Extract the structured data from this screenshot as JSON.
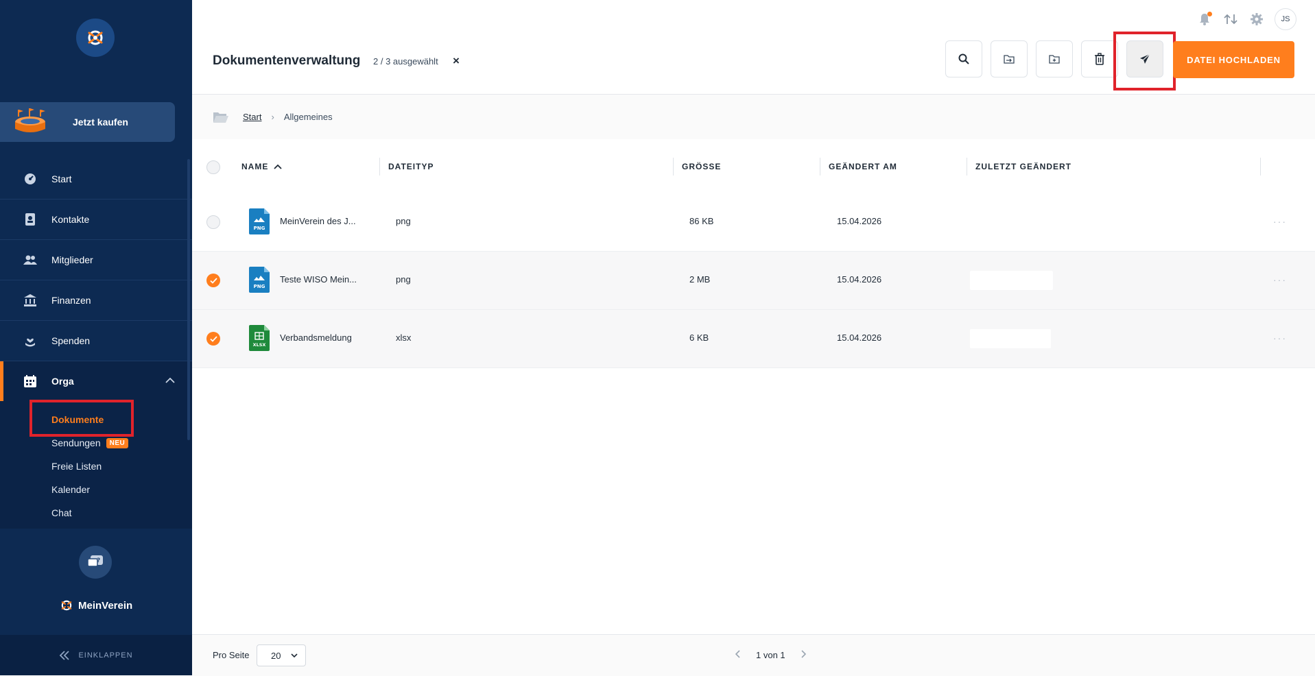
{
  "sidebar": {
    "buy_label": "Jetzt kaufen",
    "nav": [
      {
        "label": "Start",
        "icon": "dashboard-icon"
      },
      {
        "label": "Kontakte",
        "icon": "contact-card-icon"
      },
      {
        "label": "Mitglieder",
        "icon": "members-icon"
      },
      {
        "label": "Finanzen",
        "icon": "bank-icon"
      },
      {
        "label": "Spenden",
        "icon": "donation-hand-icon"
      },
      {
        "label": "Orga",
        "icon": "calendar-grid-icon"
      }
    ],
    "sub": [
      {
        "label": "Dokumente",
        "active": true
      },
      {
        "label": "Sendungen",
        "badge": "NEU"
      },
      {
        "label": "Freie Listen"
      },
      {
        "label": "Kalender"
      },
      {
        "label": "Chat"
      }
    ],
    "brand": "MeinVerein",
    "collapse_label": "EINKLAPPEN"
  },
  "topbar": {
    "avatar_initials": "JS",
    "icons": [
      "bell-icon",
      "sort-arrows-icon",
      "gear-icon"
    ]
  },
  "header": {
    "title": "Dokumentenverwaltung",
    "selected_count": "2 / 3 ausgewählt",
    "clear_symbol": "×",
    "upload_label": "DATEI HOCHLADEN",
    "tools": [
      "search-icon",
      "move-file-icon",
      "new-folder-icon",
      "trash-icon",
      "send-icon"
    ]
  },
  "breadcrumb": {
    "root": "Start",
    "separator": "›",
    "current": "Allgemeines"
  },
  "table": {
    "columns": {
      "name": "NAME",
      "type": "DATEITYP",
      "size": "GRÖSSE",
      "changed": "GEÄNDERT AM",
      "last_changed": "ZULETZT GEÄNDERT"
    },
    "rows": [
      {
        "name": "MeinVerein des J...",
        "type": "png",
        "size": "86 KB",
        "changed": "15.04.2026",
        "selected": false,
        "icon_label": "PNG",
        "icon_color": "#1a7fc1"
      },
      {
        "name": "Teste WISO Mein...",
        "type": "png",
        "size": "2 MB",
        "changed": "15.04.2026",
        "selected": true,
        "icon_label": "PNG",
        "icon_color": "#1a7fc1"
      },
      {
        "name": "Verbandsmeldung",
        "type": "xlsx",
        "size": "6 KB",
        "changed": "15.04.2026",
        "selected": true,
        "icon_label": "XLSX",
        "icon_color": "#1f8a3b"
      }
    ],
    "more_symbol": "···"
  },
  "footer": {
    "per_page_label": "Pro Seite",
    "per_page_value": "20",
    "page_info": "1 von 1"
  },
  "colors": {
    "sidebar": "#0d2a52",
    "accent": "#ff7e1d",
    "highlight": "#e0232b"
  }
}
